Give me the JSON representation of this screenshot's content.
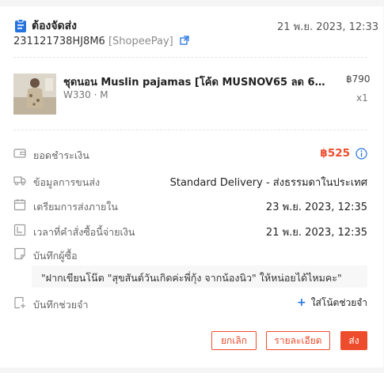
{
  "order": {
    "status": "ต้องจัดส่ง",
    "time": "21 พ.ย. 2023, 12:33",
    "id": "231121738HJ8M6",
    "payment_tag": "[ShopeePay]"
  },
  "product": {
    "name": "ชุดนอน Muslin pajamas [โค้ด MUSNOV65 ลด 65 ฿]...",
    "variant": "W330 · M",
    "price": "฿790",
    "qty": "x1"
  },
  "details": {
    "total_label": "ยอดชำระเงิน",
    "total_value": "฿525",
    "shipping_label": "ข้อมูลการขนส่ง",
    "shipping_value": "Standard Delivery - ส่งธรรมดาในประเทศ",
    "ship_by_label": "เตรียมการส่งภายใน",
    "ship_by_value": "23 พ.ย. 2023, 12:35",
    "paid_label": "เวลาที่คำสั่งซื้อนี้จ่ายเงิน",
    "paid_value": "21 พ.ย. 2023, 12:35",
    "buyer_note_label": "บันทึกผู้ซื้อ",
    "buyer_note_text": "\"ฝากเขียนโน๊ต \"สุขสันต์วันเกิดค่ะพี่กุ้ง จากน้องนิว\" ให้หน่อยได้ไหมคะ\"",
    "memo_label": "บันทึกช่วยจำ",
    "add_memo": "ใส่โน้ตช่วยจำ"
  },
  "actions": {
    "cancel": "ยกเลิก",
    "details": "รายละเอียด",
    "ship": "ส่ง"
  },
  "colors": {
    "accent": "#ee4d2d",
    "link": "#2673dd"
  }
}
